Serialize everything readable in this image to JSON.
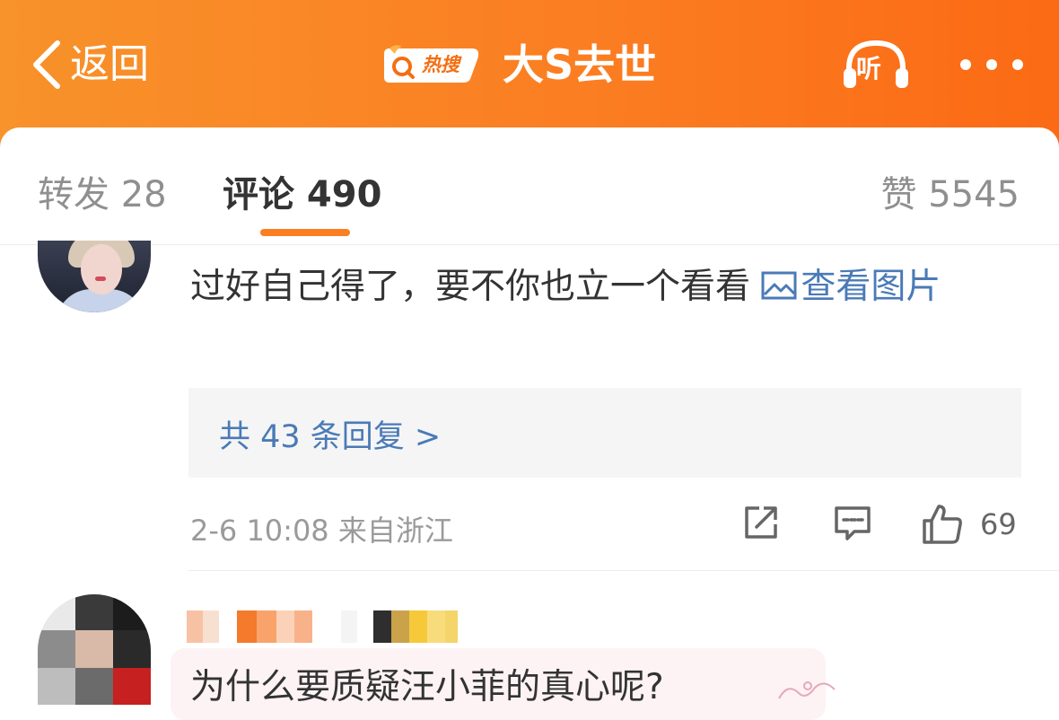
{
  "header": {
    "back_label": "返回",
    "hot_badge": "热搜",
    "title": "大S去世",
    "listen_label": "听"
  },
  "tabs": {
    "repost": "转发 28",
    "comment": "评论 490",
    "like": "赞 5545"
  },
  "comment1": {
    "text": "过好自己得了，要不你也立一个看看 ",
    "view_image": "查看图片",
    "replies": "共 43 条回复 >",
    "meta": "2-6 10:08  来自浙江",
    "like_count": "69"
  },
  "comment2": {
    "text": "为什么要质疑汪小菲的真心呢?"
  },
  "colors": {
    "header_orange": "#fb7e22",
    "link_blue": "#4a7ab7",
    "tab_underline": "#fb7e22"
  }
}
